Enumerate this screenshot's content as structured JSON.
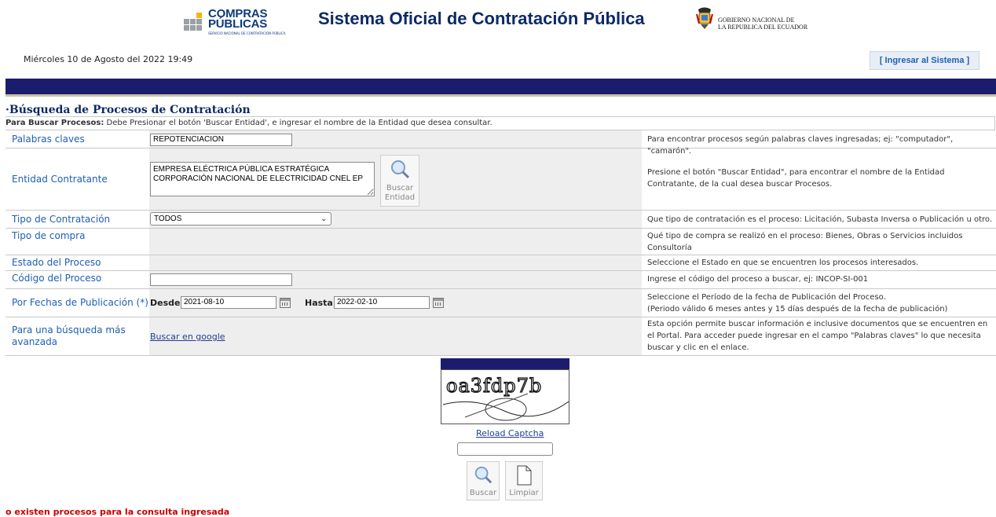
{
  "header": {
    "logo_line1": "COMPRAS",
    "logo_line2": "PÚBLICAS",
    "logo_tagline": "SERVICIO NACIONAL DE CONTRATACIÓN PÚBLICA",
    "title": "Sistema Oficial de Contratación Pública",
    "gov_line1": "GOBIERNO NACIONAL DE",
    "gov_line2": "LA REPUBLICA DEL ECUADOR",
    "date": "Miércoles 10 de Agosto del 2022 19:49",
    "login_button": "[ Ingresar al Sistema ]"
  },
  "section_title": "Búsqueda de Procesos de Contratación",
  "note": {
    "bold": "Para Buscar Procesos:",
    "text": " Debe Presionar el botón 'Buscar Entidad', e ingresar el nombre de la Entidad que desea consultar."
  },
  "form": {
    "keywords": {
      "label": "Palabras claves",
      "value": "REPOTENCIACION",
      "help": "Para encontrar procesos según palabras claves ingresadas; ej: \"computador\", \"camarón\"."
    },
    "entity": {
      "label": "Entidad Contratante",
      "value": "EMPRESA ELÉCTRICA PÚBLICA ESTRATÉGICA CORPORACIÓN NACIONAL DE ELECTRICIDAD CNEL EP",
      "button_line1": "Buscar",
      "button_line2": "Entidad",
      "help": "Presione el botón \"Buscar Entidad\", para encontrar el nombre de la Entidad Contratante, de la cual desea buscar Procesos."
    },
    "contract_type": {
      "label": "Tipo de Contratación",
      "selected": "TODOS",
      "help": "Que tipo de contratación es el proceso: Licitación, Subasta Inversa o Publicación u otro."
    },
    "purchase_type": {
      "label": "Tipo de compra",
      "help": "Qué tipo de compra se realizó en el proceso: Bienes, Obras o Servicios incluidos Consultoría"
    },
    "status": {
      "label": "Estado del Proceso",
      "help": "Seleccione el Estado en que se encuentren los procesos interesados."
    },
    "code": {
      "label": "Código del Proceso",
      "value": "",
      "help": "Ingrese el código del proceso a buscar, ej: INCOP-SI-001"
    },
    "dates": {
      "label": "Por Fechas de Publicación (*)",
      "from_label": "Desde:",
      "from_value": "2021-08-10",
      "to_label": "Hasta:",
      "to_value": "2022-02-10",
      "help_line1": "Seleccione el Período de la fecha de Publicación del Proceso.",
      "help_line2": "(Periodo válido 6 meses antes y 15 días después de la fecha de publicación)"
    },
    "advanced": {
      "label": "Para una búsqueda más avanzada",
      "link": "Buscar en google",
      "help": "Esta opción permite buscar información e inclusive documentos que se encuentren en el Portal. Para acceder puede ingresar en el campo \"Palabras claves\" lo que necesita buscar y clic en el enlace."
    }
  },
  "captcha": {
    "text": "oa3fdp7b",
    "reload": "Reload Captcha",
    "input": ""
  },
  "actions": {
    "search": "Buscar",
    "clear": "Limpiar"
  },
  "error": "o existen procesos para la consulta ingresada",
  "colors": {
    "navy": "#1c1c6e",
    "link_blue": "#1f5fb3",
    "error_red": "#cc0000"
  }
}
